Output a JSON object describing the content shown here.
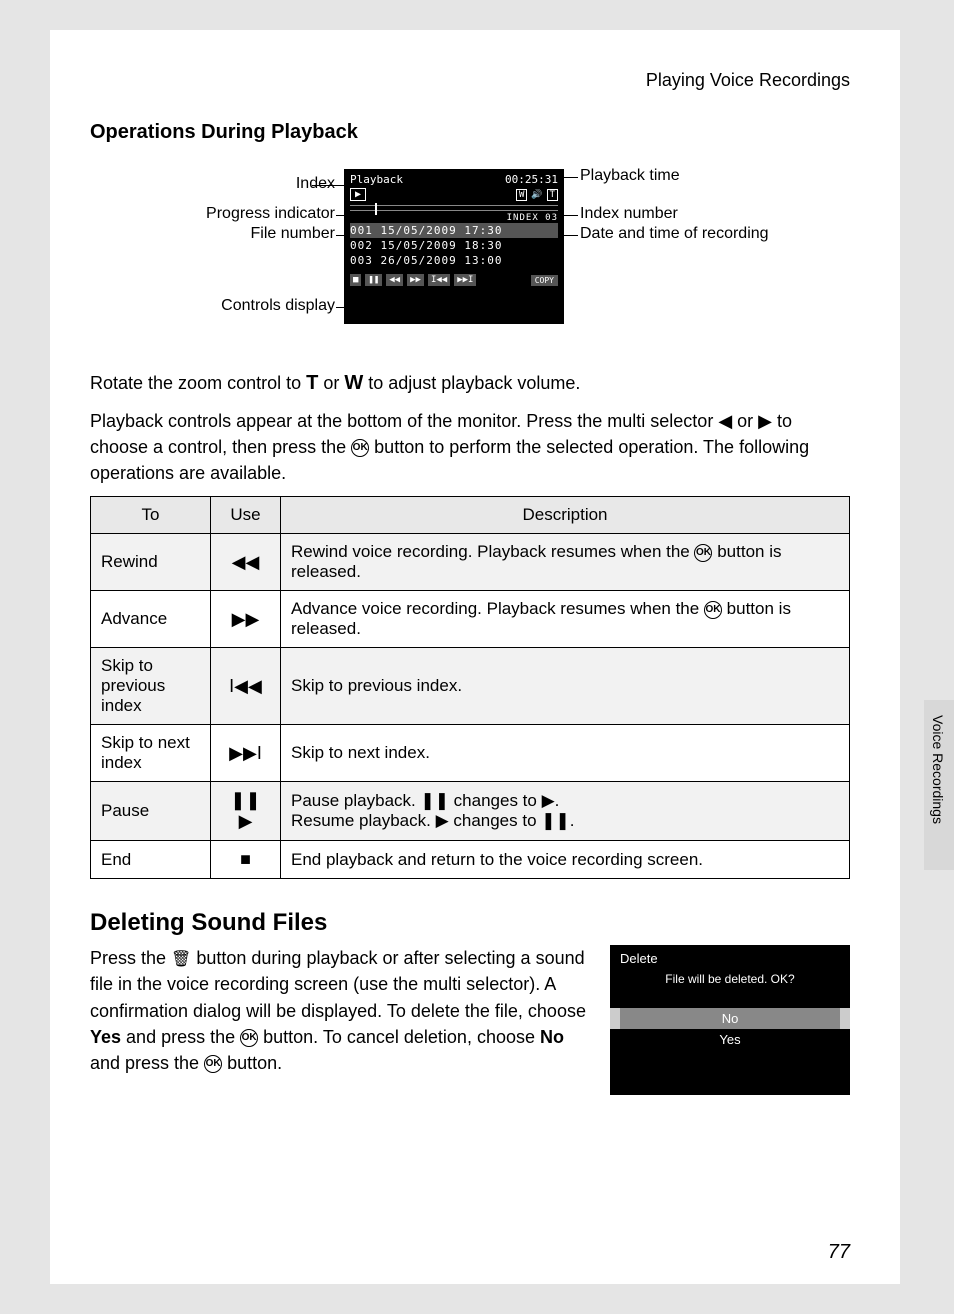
{
  "header": {
    "title": "Playing Voice Recordings"
  },
  "section1": {
    "title": "Operations During Playback"
  },
  "diagram": {
    "labels": {
      "index": "Index",
      "progress": "Progress indicator",
      "file_number": "File number",
      "controls": "Controls display",
      "playback_time": "Playback time",
      "index_number": "Index number",
      "date_time": "Date and time of recording"
    },
    "lcd": {
      "mode": "Playback",
      "time": "00:25:31",
      "index_label": "INDEX 03",
      "files": [
        {
          "num": "001",
          "date": "15/05/2009",
          "time": "17:30",
          "selected": true
        },
        {
          "num": "002",
          "date": "15/05/2009",
          "time": "18:30",
          "selected": false
        },
        {
          "num": "003",
          "date": "26/05/2009",
          "time": "13:00",
          "selected": false
        }
      ],
      "copy": "COPY"
    }
  },
  "para1_a": "Rotate the zoom control to ",
  "para1_T": "T",
  "para1_b": " or ",
  "para1_W": "W",
  "para1_c": " to adjust playback volume.",
  "para2": "Playback controls appear at the bottom of the monitor. Press the multi selector ◀ or ▶ to choose a control, then press the ",
  "para2b": " button to perform the selected operation. The following operations are available.",
  "table": {
    "headers": {
      "to": "To",
      "use": "Use",
      "desc": "Description"
    },
    "rows": [
      {
        "to": "Rewind",
        "icon": "◀◀",
        "desc_a": "Rewind voice recording. Playback resumes when the ",
        "desc_b": " button is released."
      },
      {
        "to": "Advance",
        "icon": "▶▶",
        "desc_a": "Advance voice recording. Playback resumes when the ",
        "desc_b": " button is released."
      },
      {
        "to": "Skip to previous index",
        "icon": "I◀◀",
        "desc_a": "Skip to previous index.",
        "desc_b": ""
      },
      {
        "to": "Skip to next index",
        "icon": "▶▶I",
        "desc_a": "Skip to next index.",
        "desc_b": ""
      },
      {
        "to": "Pause",
        "icon": "❚❚\n▶",
        "desc_a": "Pause playback. ❚❚ changes to ▶.\nResume playback. ▶ changes to ❚❚.",
        "desc_b": ""
      },
      {
        "to": "End",
        "icon": "■",
        "desc_a": "End playback and return to the voice recording screen.",
        "desc_b": ""
      }
    ]
  },
  "section2": {
    "title": "Deleting Sound Files",
    "text_a": "Press the ",
    "text_b": " button during playback or after selecting a sound file in the voice recording screen (use the multi selector). A confirmation dialog will be displayed. To delete the file, choose ",
    "yes": "Yes",
    "text_c": " and press the ",
    "text_d": " button. To cancel deletion, choose ",
    "no": "No",
    "text_e": " and press the ",
    "text_f": " button."
  },
  "delete_dialog": {
    "title": "Delete",
    "msg": "File will be deleted. OK?",
    "opt_no": "No",
    "opt_yes": "Yes"
  },
  "side_tab": "Voice Recordings",
  "page_number": "77",
  "ok_label": "OK"
}
